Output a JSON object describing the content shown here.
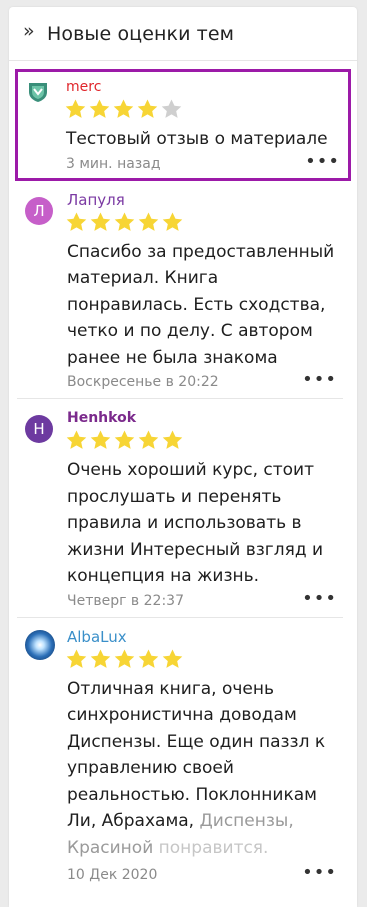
{
  "widget": {
    "title": "Новые оценки тем",
    "collapse_glyph": "»"
  },
  "colors": {
    "star_filled": "#f7d535",
    "star_empty": "#cfcfcf",
    "highlight_border": "#9c1aa8"
  },
  "reviews": [
    {
      "author": "merc",
      "author_color": "#e0262b",
      "avatar_icon": "shield-icon",
      "rating": 4,
      "text": "Тестовый отзыв о материале",
      "time": "3 мин. назад"
    },
    {
      "author": "Лапуля",
      "author_color": "#7b3aa3",
      "avatar_letter": "Л",
      "avatar_color": "#c65fc9",
      "rating": 5,
      "text": "Спасибо за предоставленный материал. Книга понравилась. Есть сходства, четко и по делу. С автором ранее не была знакома",
      "time": "Воскресенье в 20:22"
    },
    {
      "author": "Henhkok",
      "author_color": "#7b2a8c",
      "avatar_letter": "H",
      "avatar_color": "#6d3aa0",
      "rating": 5,
      "text": "Очень хороший курс, стоит прослушать и перенять правила и использовать в жизни Интересный взгляд и концепция на жизнь.",
      "time": "Четверг в 22:37"
    },
    {
      "author": "AlbaLux",
      "author_color": "#3a8fc9",
      "avatar_icon": "planet-avatar-icon",
      "rating": 5,
      "text_main": "Отличная книга, очень синхронистична доводам Диспензы. Еще один паззл к управлению своей реальностью. Поклонникам Ли, Абрахама,",
      "text_fade1": "Диспензы, Красиной",
      "text_fade2": "понравится.",
      "time": "10 Дек 2020"
    }
  ]
}
